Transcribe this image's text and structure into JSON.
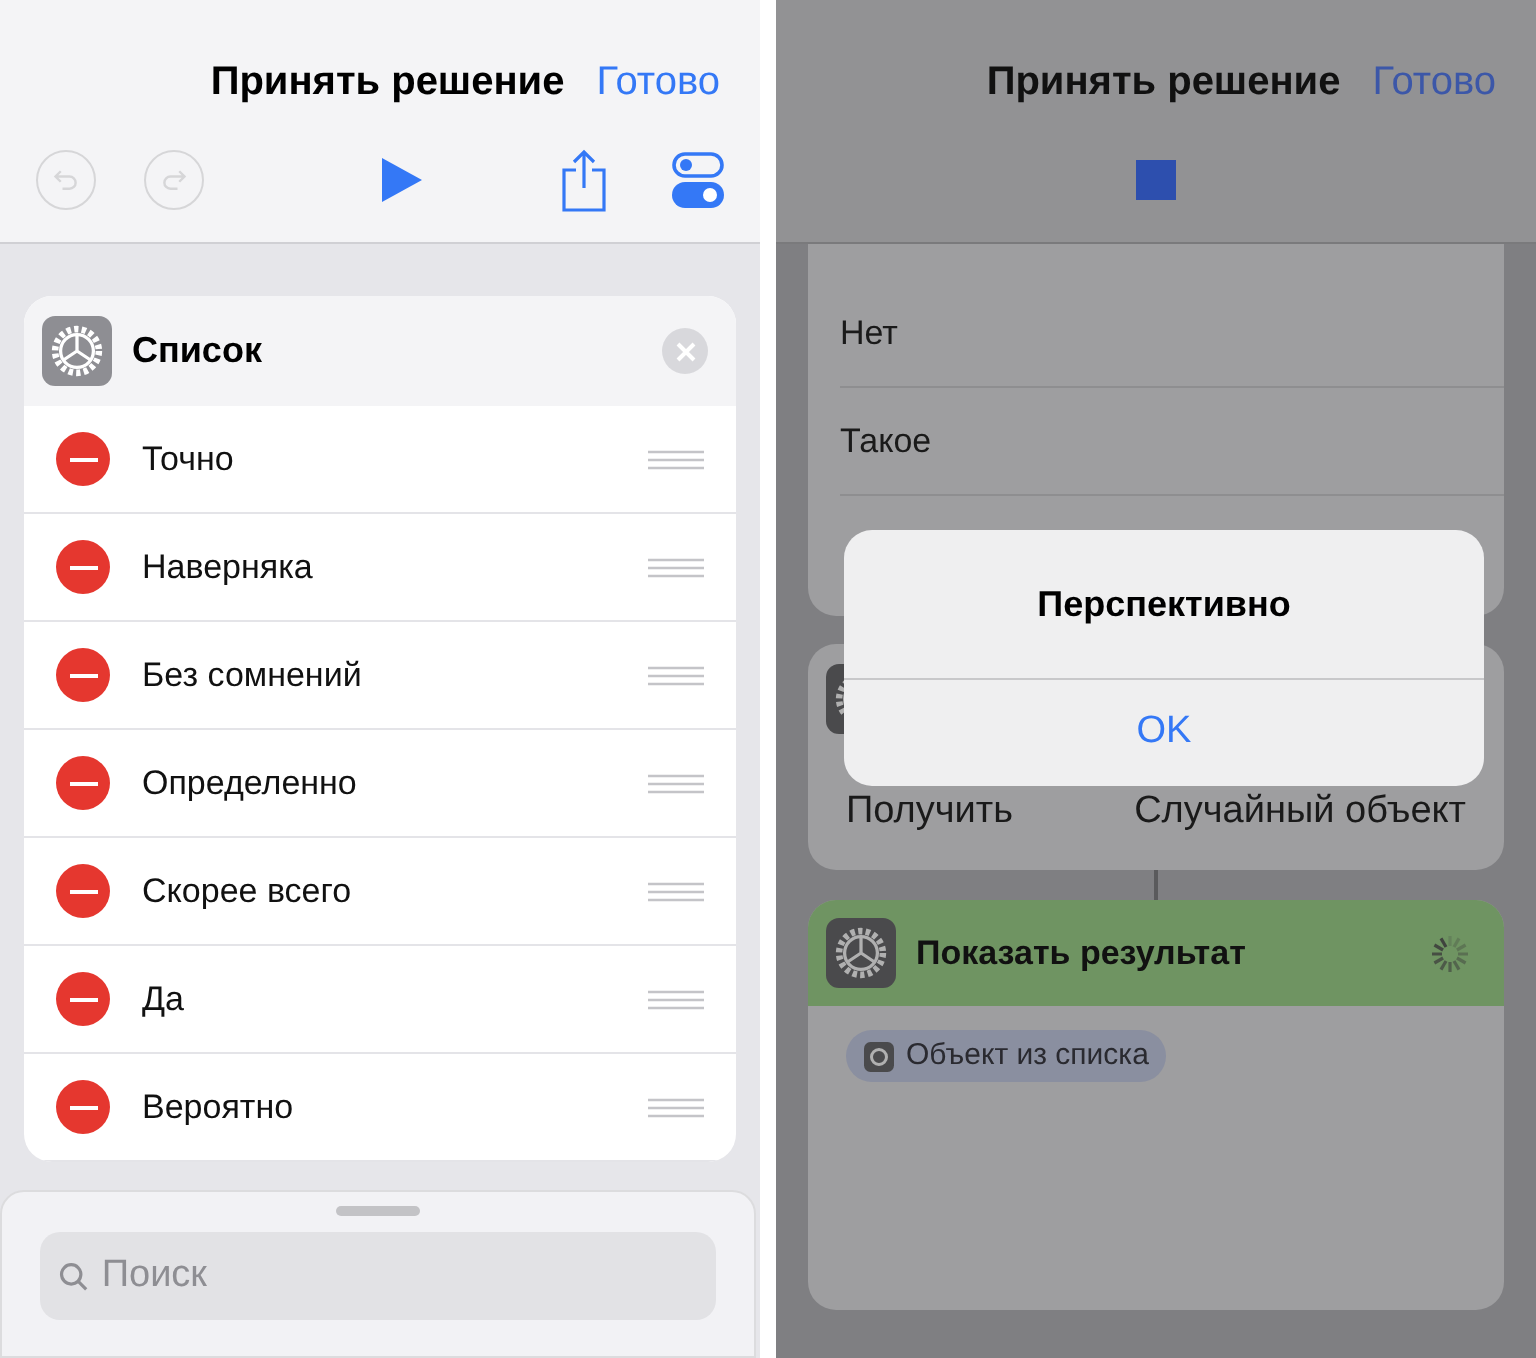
{
  "screens": [
    {
      "running": false,
      "nav": {
        "title": "Принять решение",
        "done": "Готово"
      },
      "toolbar": {
        "undo": {
          "disabled": true
        },
        "redo": {
          "disabled": true
        }
      },
      "list_card": {
        "title": "Список",
        "items": [
          "Точно",
          "Наверняка",
          "Без сомнений",
          "Определенно",
          "Скорее всего",
          "Да",
          "Вероятно"
        ]
      },
      "search": {
        "placeholder": "Поиск"
      }
    },
    {
      "running": true,
      "nav": {
        "title": "Принять решение",
        "done": "Готово"
      },
      "list_items": [
        "Нет",
        "Такое"
      ],
      "get_card": {
        "label": "Получить",
        "value": "Случайный объект"
      },
      "result_card": {
        "title": "Показать результат",
        "chip": "Объект из списка"
      },
      "alert": {
        "title": "Перспективно",
        "button": "OK"
      }
    }
  ]
}
